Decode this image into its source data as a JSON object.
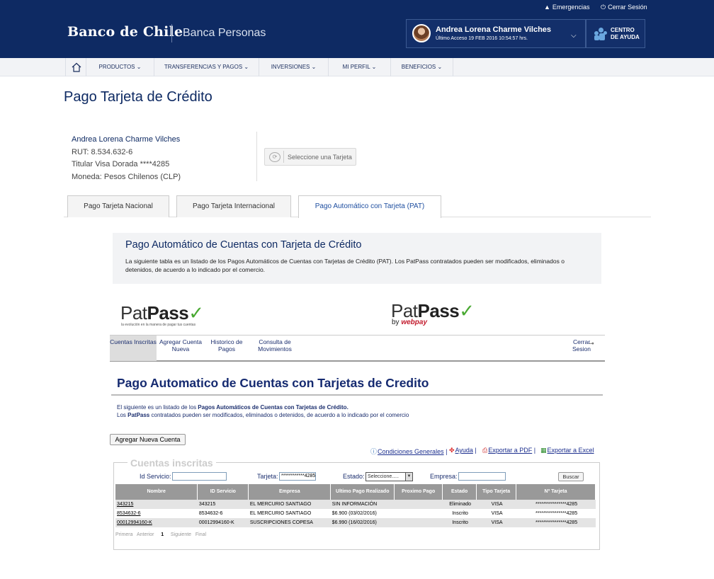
{
  "header": {
    "emergency_label": "Emergencias",
    "logout_label": "Cerrar Sesión",
    "logo_text": "Banco de Chile",
    "brand_sub": "Banca Personas",
    "user_name": "Andrea Lorena Charme Vilches",
    "last_access": "Último Acceso 19 FEB 2016 10:54:57 hrs.",
    "help_line1": "CENTRO",
    "help_line2": "DE AYUDA"
  },
  "nav": {
    "items": [
      "PRODUCTOS",
      "TRANSFERENCIAS Y PAGOS",
      "INVERSIONES",
      "MI PERFIL",
      "BENEFICIOS"
    ]
  },
  "page": {
    "title": "Pago Tarjeta de Crédito"
  },
  "account": {
    "name": "Andrea Lorena Charme Vilches",
    "rut": "RUT: 8.534.632-6",
    "card": "Titular Visa Dorada ****4285",
    "currency": "Moneda: Pesos Chilenos (CLP)",
    "select_card_label": "Seleccione una Tarjeta"
  },
  "tabs": [
    "Pago Tarjeta Nacional",
    "Pago Tarjeta Internacional",
    "Pago Automático con Tarjeta (PAT)"
  ],
  "info": {
    "title": "Pago Automático de Cuentas con Tarjeta de Crédito",
    "text": "La siguiente tabla es un listado de los Pagos Automáticos de Cuentas con Tarjetas de Crédito (PAT). Los PatPass contratados pueden ser modificados, eliminados o detenidos, de acuerdo a lo indicado por el comercio."
  },
  "patpass": {
    "pat": "Pat",
    "pass": "Pass",
    "check": "✓",
    "tagline": "la evolución en la manera de pagar tus cuentas",
    "by": "by",
    "webpay": "webpay"
  },
  "oldnav": {
    "items": [
      "Cuentas Inscritas",
      "Agregar Cuenta Nueva",
      "Historico de Pagos",
      "Consulta de Movimientos"
    ],
    "logout": "Cerrar Sesion"
  },
  "pat_app": {
    "title": "Pago Automatico de Cuentas con Tarjetas de Credito",
    "desc_line1_a": "El siguiente es un listado de los ",
    "desc_line1_b": "Pagos Automáticos de Cuentas con Tarjetas de Crédito.",
    "desc_line2_a": "Los ",
    "desc_line2_b": "PatPass",
    "desc_line2_c": " contratados pueden ser modificados, eliminados o detenidos, de acuerdo a lo indicado por el comercio",
    "add_button": "Agregar Nueva Cuenta",
    "links": {
      "conditions": "Condiciones Generales",
      "help": "Ayuda",
      "pdf": "Exportar a PDF",
      "excel": "Exportar a Excel"
    },
    "filter": {
      "legend": "Cuentas inscritas",
      "id_label": "Id Servicio:",
      "card_label": "Tarjeta:",
      "card_value": "************4285",
      "status_label": "Estado:",
      "status_value": "Seleccione.....",
      "company_label": "Empresa:",
      "search_button": "Buscar"
    },
    "table": {
      "headers": [
        "Nombre",
        "ID Servicio",
        "Empresa",
        "Ultimo Pago Realizado",
        "Proximo Pago",
        "Estado",
        "Tipo Tarjeta",
        "Nº Tarjeta"
      ],
      "rows": [
        [
          "343215",
          "343215",
          "EL MERCURIO SANTIAGO",
          "SIN INFORMACIÓN",
          "",
          "Eliminado",
          "VISA",
          "****************4285"
        ],
        [
          "8534632-6",
          "8534632-6",
          "EL MERCURIO SANTIAGO",
          "$6.900 (03/02/2016)",
          "",
          "Inscrito",
          "VISA",
          "****************4285"
        ],
        [
          "00012994160-K",
          "00012994160-K",
          "SUSCRIPCIONES COPESA",
          "$6.990 (16/02/2016)",
          "",
          "Inscrito",
          "VISA",
          "****************4285"
        ]
      ]
    },
    "pager": {
      "first": "Primera",
      "prev": "Anterior",
      "page": "1",
      "next": "Siguiente",
      "last": "Final"
    }
  }
}
